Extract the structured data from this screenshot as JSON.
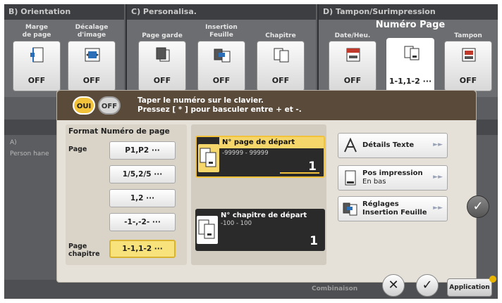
{
  "sections": {
    "orientation": {
      "title": "B) Orientation",
      "tiles": [
        {
          "label": "Marge\nde page",
          "value": "OFF",
          "icon": "page-margin-icon"
        },
        {
          "label": "Décalage\nd'image",
          "value": "OFF",
          "icon": "image-shift-icon"
        }
      ]
    },
    "personalise": {
      "title": "C) Personalisa.",
      "tiles": [
        {
          "label": "Page garde",
          "value": "OFF",
          "icon": "cover-page-icon"
        },
        {
          "label": "Insertion\nFeuille",
          "value": "OFF",
          "icon": "insert-sheet-icon"
        },
        {
          "label": "Chapitre",
          "value": "OFF",
          "icon": "chapter-icon"
        }
      ]
    },
    "stamp": {
      "title": "D) Tampon/Surimpression",
      "tiles": [
        {
          "label": "Date/Heu.",
          "value": "OFF",
          "icon": "date-time-icon"
        },
        {
          "label": "Numéro Page",
          "value": "1-1,1-2 ···",
          "icon": "page-number-icon"
        },
        {
          "label": "Tampon",
          "value": "OFF",
          "icon": "stamp-icon"
        }
      ]
    }
  },
  "background": {
    "left_label_a": "A)",
    "left_label_b": "Person hane",
    "bottom_text": "Combinaison"
  },
  "dialog": {
    "toggle_on": "OUI",
    "toggle_off": "OFF",
    "instruction_line1": "Taper le numéro sur le clavier.",
    "instruction_line2": "Pressez [ * ] pour basculer entre + et -.",
    "format": {
      "title": "Format Numéro de page",
      "page_label": "Page",
      "chapter_label": "Page\nchapitre",
      "options": [
        "P1,P2 ···",
        "1/5,2/5 ···",
        "1,2 ···",
        "-1-,-2- ···",
        "1-1,1-2 ···"
      ],
      "selected_index": 4
    },
    "start_page": {
      "label": "N° page de départ",
      "range": "-99999 - 99999",
      "value": "1"
    },
    "start_chapter": {
      "label": "N° chapitre de départ",
      "range": "-100 - 100",
      "value": "1"
    },
    "options": {
      "text_details": "Détails Texte",
      "print_pos_line1": "Pos impression",
      "print_pos_line2": "En bas",
      "insert_line1": "Réglages",
      "insert_line2": "Insertion Feuille"
    }
  },
  "buttons": {
    "cancel": "✕",
    "ok": "✓",
    "side_ok": "✓",
    "application": "Application"
  },
  "colors": {
    "highlight": "#f2c23b",
    "panel_bg": "#5b5d60",
    "dialog_bg": "#e6e1d8"
  }
}
